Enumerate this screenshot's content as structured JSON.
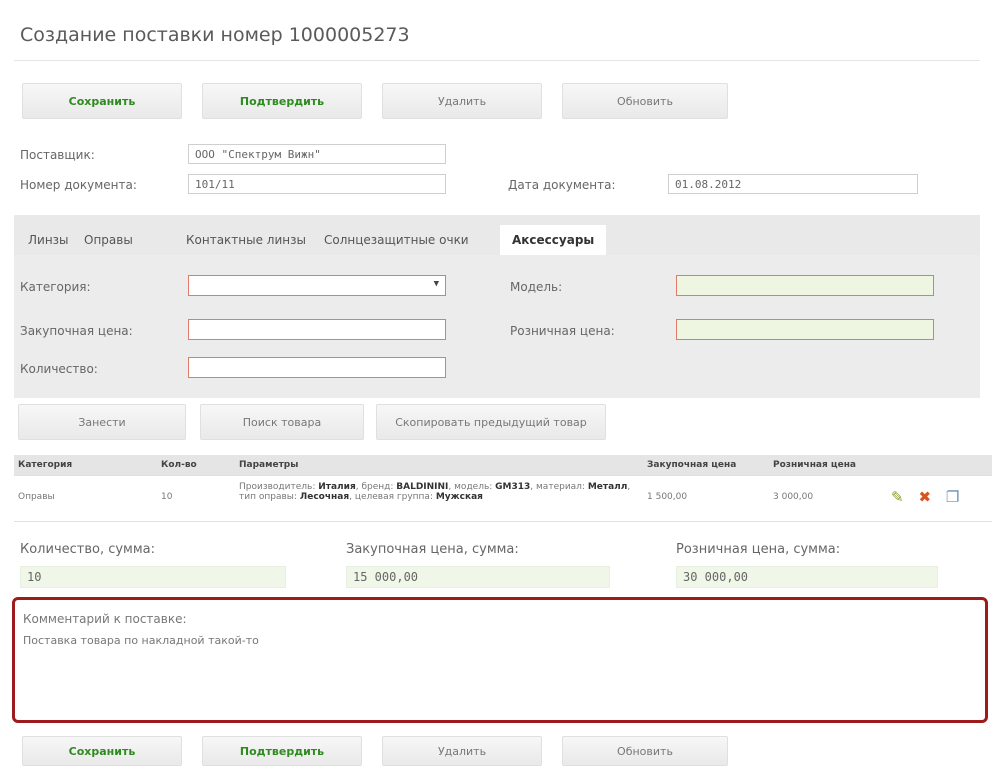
{
  "page_title": "Создание поставки номер 1000005273",
  "toolbar": {
    "save": "Сохранить",
    "confirm": "Подтвердить",
    "delete": "Удалить",
    "refresh": "Обновить"
  },
  "header_form": {
    "supplier_label": "Поставщик:",
    "supplier_value": "ООО \"Спектрум Вижн\"",
    "doc_number_label": "Номер документа:",
    "doc_number_value": "101/11",
    "doc_date_label": "Дата документа:",
    "doc_date_value": "01.08.2012"
  },
  "tabs": [
    {
      "label": "Линзы",
      "active": false
    },
    {
      "label": "Оправы",
      "active": false
    },
    {
      "label": "Контактные линзы",
      "active": false
    },
    {
      "label": "Солнцезащитные очки",
      "active": false
    },
    {
      "label": "Аксессуары",
      "active": true
    }
  ],
  "item_form": {
    "category_label": "Категория:",
    "category_value": "",
    "model_label": "Модель:",
    "model_value": "",
    "purchase_price_label": "Закупочная цена:",
    "purchase_price_value": "",
    "retail_price_label": "Розничная цена:",
    "retail_price_value": "",
    "quantity_label": "Количество:",
    "quantity_value": ""
  },
  "item_actions": {
    "add": "Занести",
    "search": "Поиск товара",
    "copy_prev": "Скопировать предыдущий товар"
  },
  "table": {
    "headers": [
      "Категория",
      "Кол-во",
      "Параметры",
      "Закупочная цена",
      "Розничная цена"
    ],
    "rows": [
      {
        "category": "Оправы",
        "qty": "10",
        "params": {
          "p1": "Производитель: ",
          "b1": "Италия",
          "p2": ", бренд: ",
          "b2": "BALDININI",
          "p3": ", модель: ",
          "b3": "GM313",
          "p4": ", материал: ",
          "b4": "Металл",
          "p5": ", тип оправы: ",
          "b5": "Лесочная",
          "p6": ", целевая группа: ",
          "b6": "Мужская"
        },
        "purchase": "1 500,00",
        "retail": "3 000,00"
      }
    ]
  },
  "totals": {
    "qty_label": "Количество, сумма:",
    "qty_value": "10",
    "purchase_label": "Закупочная цена, сумма:",
    "purchase_value": "15 000,00",
    "retail_label": "Розничная цена, сумма:",
    "retail_value": "30 000,00"
  },
  "comment": {
    "label": "Комментарий к поставке:",
    "value": "Поставка товара по накладной такой-то"
  },
  "colors": {
    "green_text": "#2e8b1f",
    "highlight_border": "#9e1b1b",
    "required_border": "#e07a6a"
  }
}
